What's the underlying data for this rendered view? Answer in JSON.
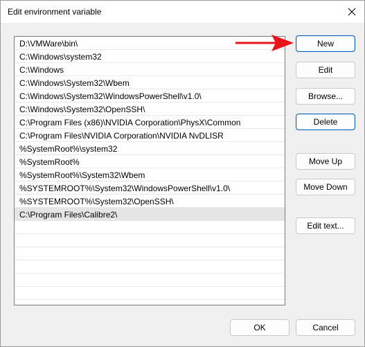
{
  "window": {
    "title": "Edit environment variable"
  },
  "list": {
    "items": [
      "D:\\VMWare\\bin\\",
      "C:\\Windows\\system32",
      "C:\\Windows",
      "C:\\Windows\\System32\\Wbem",
      "C:\\Windows\\System32\\WindowsPowerShell\\v1.0\\",
      "C:\\Windows\\System32\\OpenSSH\\",
      "C:\\Program Files (x86)\\NVIDIA Corporation\\PhysX\\Common",
      "C:\\Program Files\\NVIDIA Corporation\\NVIDIA NvDLISR",
      "%SystemRoot%\\system32",
      "%SystemRoot%",
      "%SystemRoot%\\System32\\Wbem",
      "%SYSTEMROOT%\\System32\\WindowsPowerShell\\v1.0\\",
      "%SYSTEMROOT%\\System32\\OpenSSH\\",
      "C:\\Program Files\\Calibre2\\"
    ],
    "selected_index": 13
  },
  "buttons": {
    "new": "New",
    "edit": "Edit",
    "browse": "Browse...",
    "delete": "Delete",
    "move_up": "Move Up",
    "move_down": "Move Down",
    "edit_text": "Edit text...",
    "ok": "OK",
    "cancel": "Cancel"
  },
  "colors": {
    "annotation_arrow": "#e8141c",
    "focus_border": "#005fb8"
  },
  "icons": {
    "close": "close-icon",
    "annotation": "red-arrow-icon"
  }
}
